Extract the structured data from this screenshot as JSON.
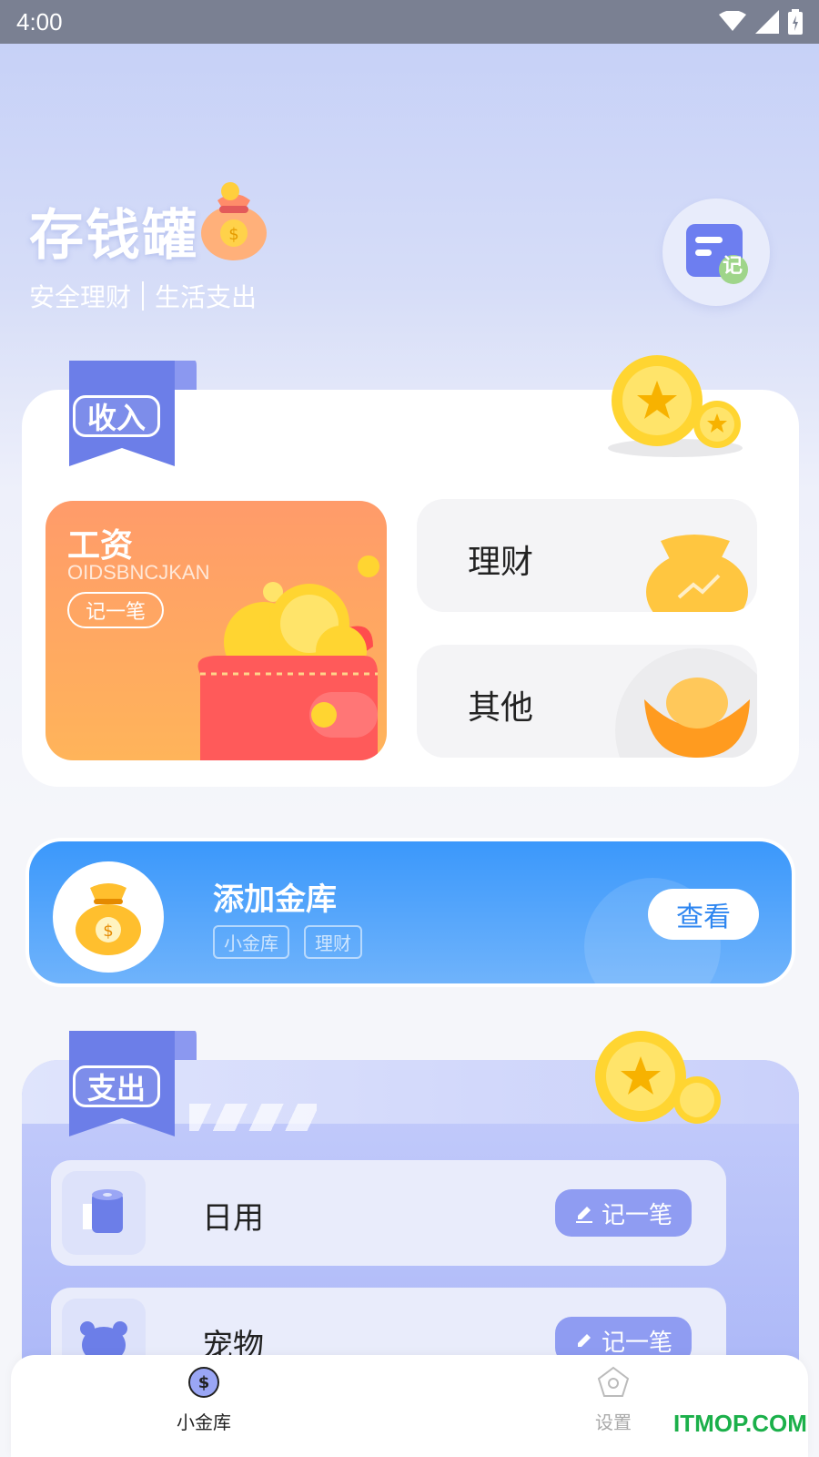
{
  "status_bar": {
    "time": "4:00"
  },
  "header": {
    "title": "存钱罐",
    "subtitle_left": "安全理财",
    "subtitle_right": "生活支出",
    "note_icon_text": "记"
  },
  "income": {
    "ribbon_label": "收入",
    "salary": {
      "name": "工资",
      "code": "OIDSBNCJKAN",
      "record_label": "记一笔"
    },
    "finance_label": "理财",
    "other_label": "其他"
  },
  "add_vault": {
    "title": "添加金库",
    "tags": [
      "小金库",
      "理财"
    ],
    "view_label": "查看"
  },
  "expense": {
    "ribbon_label": "支出",
    "rows": [
      {
        "label": "日用",
        "record_label": "记一笔"
      },
      {
        "label": "宠物",
        "record_label": "记一笔"
      }
    ]
  },
  "bottom_nav": {
    "items": [
      {
        "label": "小金库",
        "active": true
      },
      {
        "label": "设置",
        "active": false
      }
    ]
  },
  "watermark": "ITMOP.COM",
  "colors": {
    "accent_blue": "#3b98fb",
    "ribbon_purple": "#6c7ee8",
    "salary_orange": "#ff9b6a",
    "record_button": "#8f9cf2"
  }
}
